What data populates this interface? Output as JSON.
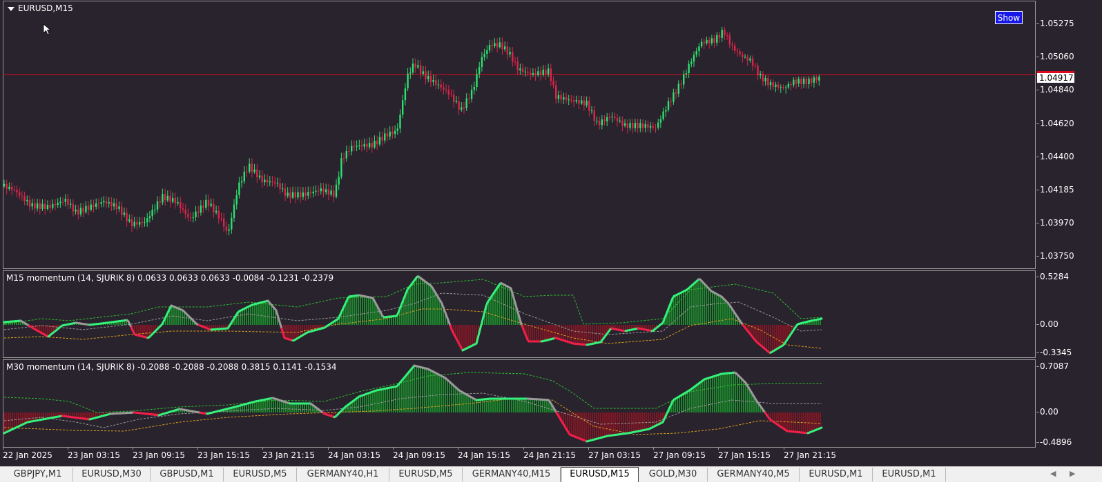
{
  "main_chart": {
    "symbol_title": "EURUSD,M15",
    "show_button": "Show",
    "current_price": "1.04917",
    "price_levels": [
      "1.05275",
      "1.05060",
      "1.04840",
      "1.04620",
      "1.04400",
      "1.04185",
      "1.03970",
      "1.03750"
    ],
    "bull_color": "#2ee06e",
    "bear_color": "#e0234a",
    "price_line_color": "#e0081e"
  },
  "m15_indicator": {
    "title": "M15 momentum (14,  SJURIK 8) 0.0633 0.0633 0.0633 -0.0084 -0.1231 -0.2379",
    "levels": [
      "0.5284",
      "0.00",
      "-0.3345"
    ]
  },
  "m30_indicator": {
    "title": "M30 momentum (14,  SJURIK 8) -0.2088 -0.2088 -0.2088 0.3815 0.1141 -0.1534",
    "levels": [
      "0.7087",
      "0.00",
      "-0.4896"
    ]
  },
  "time_axis": [
    "22 Jan 2025",
    "23 Jan 03:15",
    "23 Jan 09:15",
    "23 Jan 15:15",
    "23 Jan 21:15",
    "24 Jan 03:15",
    "24 Jan 09:15",
    "24 Jan 15:15",
    "24 Jan 21:15",
    "27 Jan 03:15",
    "27 Jan 09:15",
    "27 Jan 15:15",
    "27 Jan 21:15"
  ],
  "tabs": [
    "GBPJPY,M1",
    "EURUSD,M30",
    "GBPUSD,M1",
    "EURUSD,M5",
    "GERMANY40,H1",
    "EURUSD,M5",
    "GERMANY40,M15",
    "EURUSD,M15",
    "GOLD,M30",
    "GERMANY40,M5",
    "EURUSD,M1",
    "EURUSD,M1"
  ],
  "active_tab": "EURUSD,M15"
}
